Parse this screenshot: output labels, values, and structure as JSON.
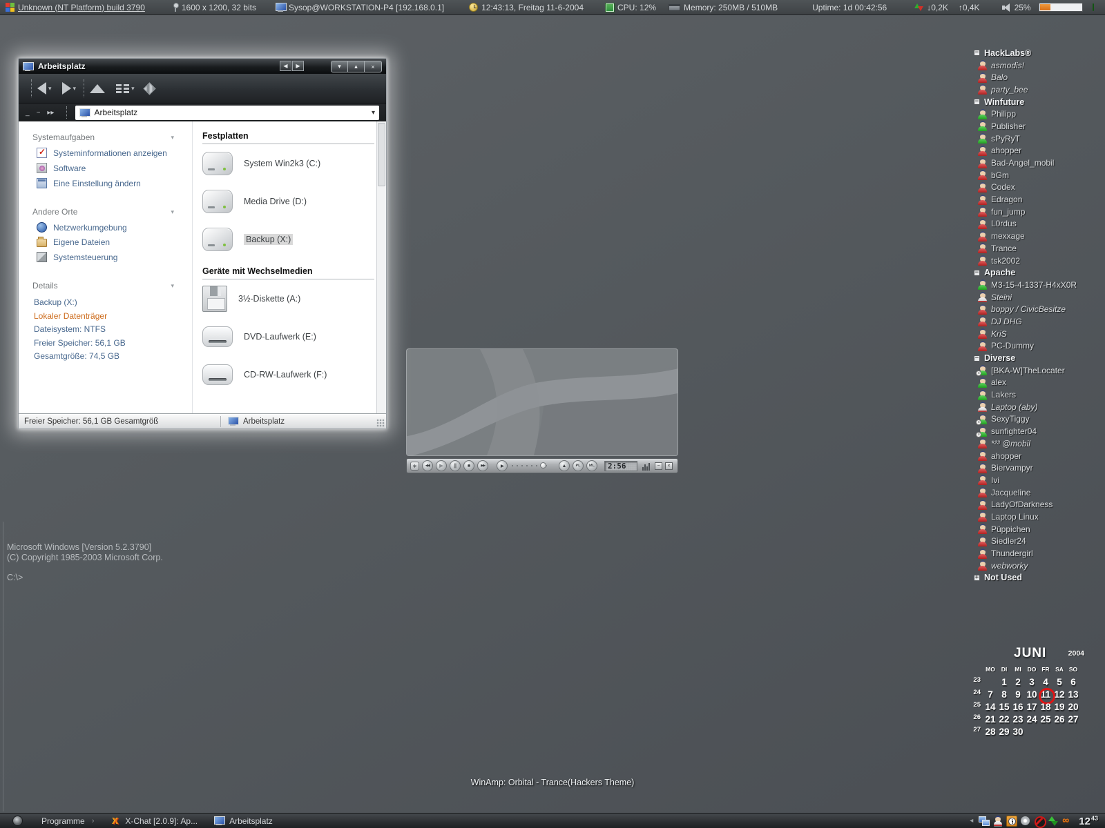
{
  "topbar": {
    "os_build": "Unknown (NT Platform) build 3790",
    "resolution": "1600 x 1200, 32 bits",
    "host": "Sysop@WORKSTATION-P4 [192.168.0.1]",
    "datetime": "12:43:13, Freitag 11-6-2004",
    "cpu": "CPU: 12%",
    "memory": "Memory: 250MB / 510MB",
    "uptime": "Uptime: 1d 00:42:56",
    "net_down": "↓0,2K",
    "net_up": "↑0,4K",
    "volume_label": "25%",
    "volume_percent": 25,
    "tray_icons": [
      {
        "id": "gmx-sms"
      },
      {
        "id": "jap"
      },
      {
        "id": "remote"
      },
      {
        "id": "people"
      }
    ]
  },
  "explorer": {
    "title": "Arbeitsplatz",
    "titlebar": {
      "nav_prev": "◀",
      "nav_next": "▶",
      "min": "▾",
      "max": "▴",
      "close": "×"
    },
    "caret": "▾",
    "address_small": [
      "_",
      "~",
      "▸▸"
    ],
    "address": "Arbeitsplatz",
    "sidebar": {
      "sections": [
        {
          "title": "Systemaufgaben",
          "items": [
            "Systeminformationen anzeigen",
            "Software",
            "Eine Einstellung ändern"
          ]
        },
        {
          "title": "Andere Orte",
          "items": [
            "Netzwerkumgebung",
            "Eigene Dateien",
            "Systemsteuerung"
          ]
        },
        {
          "title": "Details",
          "lines": [
            "Backup (X:)",
            "Lokaler Datenträger",
            "Dateisystem: NTFS",
            "Freier Speicher: 56,1 GB",
            "Gesamtgröße: 74,5 GB"
          ]
        }
      ]
    },
    "content": {
      "sections": [
        {
          "title": "Festplatten",
          "items": [
            "System Win2k3 (C:)",
            "Media Drive (D:)",
            "Backup (X:)"
          ]
        },
        {
          "title": "Geräte mit Wechselmedien",
          "items": [
            "3½-Diskette (A:)",
            "DVD-Laufwerk (E:)",
            "CD-RW-Laufwerk (F:)"
          ]
        }
      ],
      "selected_item": "Backup (X:)"
    },
    "statusbar": {
      "left": "Freier Speicher: 56,1 GB Gesamtgröß",
      "location": "Arbeitsplatz"
    }
  },
  "player": {
    "time": "2:56",
    "playlist_label": "PL",
    "medialib_label": "ML",
    "minimize_glyph": "−",
    "close_glyph": "×"
  },
  "contactlist": {
    "rows": [
      {
        "kind": "group",
        "label": "HackLabs®",
        "toggle": "−"
      },
      {
        "kind": "contact",
        "name": "asmodis!",
        "status": "offline",
        "italic": true
      },
      {
        "kind": "contact",
        "name": "Balo",
        "status": "offline",
        "italic": true
      },
      {
        "kind": "contact",
        "name": "party_bee",
        "status": "offline",
        "italic": true
      },
      {
        "kind": "group",
        "label": "Winfuture",
        "toggle": "−"
      },
      {
        "kind": "contact",
        "name": "Philipp",
        "status": "online"
      },
      {
        "kind": "contact",
        "name": "Publisher",
        "status": "online"
      },
      {
        "kind": "contact",
        "name": "sPyRyT",
        "status": "online"
      },
      {
        "kind": "contact",
        "name": "ahopper",
        "status": "offline"
      },
      {
        "kind": "contact",
        "name": "Bad-Angel_mobil",
        "status": "offline"
      },
      {
        "kind": "contact",
        "name": "bGm",
        "status": "offline"
      },
      {
        "kind": "contact",
        "name": "Codex",
        "status": "offline"
      },
      {
        "kind": "contact",
        "name": "Edragon",
        "status": "offline"
      },
      {
        "kind": "contact",
        "name": "fun_jump",
        "status": "offline"
      },
      {
        "kind": "contact",
        "name": "L0rdus",
        "status": "offline"
      },
      {
        "kind": "contact",
        "name": "mexxage",
        "status": "offline"
      },
      {
        "kind": "contact",
        "name": "Trance",
        "status": "offline"
      },
      {
        "kind": "contact",
        "name": "tsk2002",
        "status": "offline"
      },
      {
        "kind": "group",
        "label": "Apache",
        "toggle": "−"
      },
      {
        "kind": "contact",
        "name": "M3-15-4-1337-H4xX0R",
        "status": "online"
      },
      {
        "kind": "contact",
        "name": "Steini",
        "status": "na",
        "italic": true
      },
      {
        "kind": "contact",
        "name": "boppy / CivicBesitze",
        "status": "offline",
        "italic": true
      },
      {
        "kind": "contact",
        "name": "DJ DHG",
        "status": "offline",
        "italic": true
      },
      {
        "kind": "contact",
        "name": "KriS",
        "status": "offline",
        "italic": true
      },
      {
        "kind": "contact",
        "name": "PC-Dummy",
        "status": "offline"
      },
      {
        "kind": "group",
        "label": "Diverse",
        "toggle": "−"
      },
      {
        "kind": "contact",
        "name": "[BKA-W]TheLocater",
        "status": "online",
        "clock": true
      },
      {
        "kind": "contact",
        "name": "alex",
        "status": "online"
      },
      {
        "kind": "contact",
        "name": "Lakers",
        "status": "online"
      },
      {
        "kind": "contact",
        "name": "Laptop (aby)",
        "status": "na",
        "italic": true
      },
      {
        "kind": "contact",
        "name": "SexyTiggy",
        "status": "online",
        "clock": true
      },
      {
        "kind": "contact",
        "name": "sunfighter04",
        "status": "online",
        "clock": true
      },
      {
        "kind": "contact",
        "name": "*²³ @mobil",
        "status": "offline",
        "italic": true
      },
      {
        "kind": "contact",
        "name": "ahopper",
        "status": "offline"
      },
      {
        "kind": "contact",
        "name": "Biervampyr",
        "status": "offline"
      },
      {
        "kind": "contact",
        "name": "Ivi",
        "status": "offline"
      },
      {
        "kind": "contact",
        "name": "Jacqueline",
        "status": "offline"
      },
      {
        "kind": "contact",
        "name": "LadyOfDarkness",
        "status": "offline"
      },
      {
        "kind": "contact",
        "name": "Laptop Linux",
        "status": "offline"
      },
      {
        "kind": "contact",
        "name": "Püppichen",
        "status": "offline"
      },
      {
        "kind": "contact",
        "name": "Siedler24",
        "status": "offline"
      },
      {
        "kind": "contact",
        "name": "Thundergirl",
        "status": "offline"
      },
      {
        "kind": "contact",
        "name": "webworky",
        "status": "offline",
        "italic": true
      },
      {
        "kind": "group",
        "label": "Not Used",
        "toggle": "+"
      }
    ]
  },
  "calendar": {
    "month": "JUNI",
    "year": "2004",
    "day_headers": [
      "MO",
      "DI",
      "MI",
      "DO",
      "FR",
      "SA",
      "SO"
    ],
    "weeks": [
      {
        "num": "23",
        "days": [
          "",
          "1",
          "2",
          "3",
          "4",
          "5",
          "6"
        ]
      },
      {
        "num": "24",
        "days": [
          "7",
          "8",
          "9",
          "10",
          "11",
          "12",
          "13"
        ]
      },
      {
        "num": "25",
        "days": [
          "14",
          "15",
          "16",
          "17",
          "18",
          "19",
          "20"
        ]
      },
      {
        "num": "26",
        "days": [
          "21",
          "22",
          "23",
          "24",
          "25",
          "26",
          "27"
        ]
      },
      {
        "num": "27",
        "days": [
          "28",
          "29",
          "30",
          "",
          "",
          "",
          ""
        ]
      }
    ],
    "highlight_day": "11"
  },
  "console": {
    "line1": "Microsoft Windows [Version 5.2.3790]",
    "line2": "(C) Copyright 1985-2003 Microsoft Corp.",
    "prompt": "C:\\>"
  },
  "nowplaying": "WinAmp: Orbital - Trance(Hackers Theme)",
  "taskbar": {
    "start_label": "Programme",
    "start_arrow": "›",
    "tray_arrow": "◂",
    "tasks": [
      {
        "label": "X-Chat [2.0.9]: Ap..."
      },
      {
        "label": "Arbeitsplatz"
      }
    ],
    "clock_hour": "12",
    "clock_min": "43",
    "tray_icons": [
      {
        "id": "network"
      },
      {
        "id": "buddy"
      },
      {
        "id": "clock"
      },
      {
        "id": "cd"
      },
      {
        "id": "mute"
      },
      {
        "id": "updown"
      },
      {
        "id": "app"
      }
    ]
  }
}
